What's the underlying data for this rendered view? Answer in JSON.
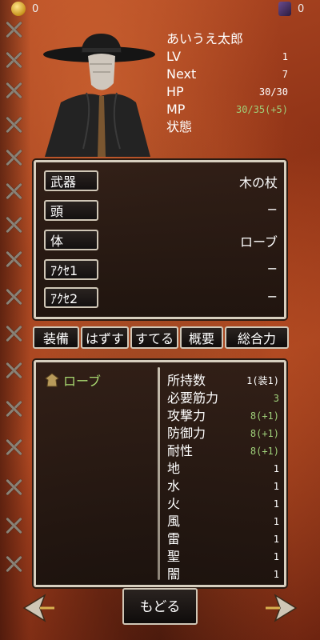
{
  "currency": {
    "gold": "0",
    "gems": "0"
  },
  "character": {
    "name": "あいうえ太郎",
    "rows": [
      {
        "label": "LV",
        "value": "1"
      },
      {
        "label": "Next",
        "value": "7"
      },
      {
        "label": "HP",
        "value": "30/30"
      },
      {
        "label": "MP",
        "value": "30/35(+5)"
      },
      {
        "label": "状態",
        "value": ""
      }
    ]
  },
  "equipment": [
    {
      "slot": "武器",
      "item": "木の杖"
    },
    {
      "slot": "頭",
      "item": "−"
    },
    {
      "slot": "体",
      "item": "ローブ"
    },
    {
      "slot": "ｱｸｾ1",
      "item": "−"
    },
    {
      "slot": "ｱｸｾ2",
      "item": "−"
    }
  ],
  "commands": [
    "装備",
    "はずす",
    "すてる",
    "概要",
    "総合力"
  ],
  "selected_item": {
    "name": "ローブ"
  },
  "item_stats": [
    {
      "label": "所持数",
      "value": "1(装1)"
    },
    {
      "label": "必要筋力",
      "value": "3"
    },
    {
      "label": "攻撃力",
      "value": "8(+1)"
    },
    {
      "label": "防御力",
      "value": "8(+1)"
    },
    {
      "label": "耐性",
      "value": "8(+1)"
    },
    {
      "label": "地",
      "value": "1"
    },
    {
      "label": "水",
      "value": "1"
    },
    {
      "label": "火",
      "value": "1"
    },
    {
      "label": "風",
      "value": "1"
    },
    {
      "label": "雷",
      "value": "1"
    },
    {
      "label": "聖",
      "value": "1"
    },
    {
      "label": "闇",
      "value": "1"
    }
  ],
  "back_label": "もどる"
}
